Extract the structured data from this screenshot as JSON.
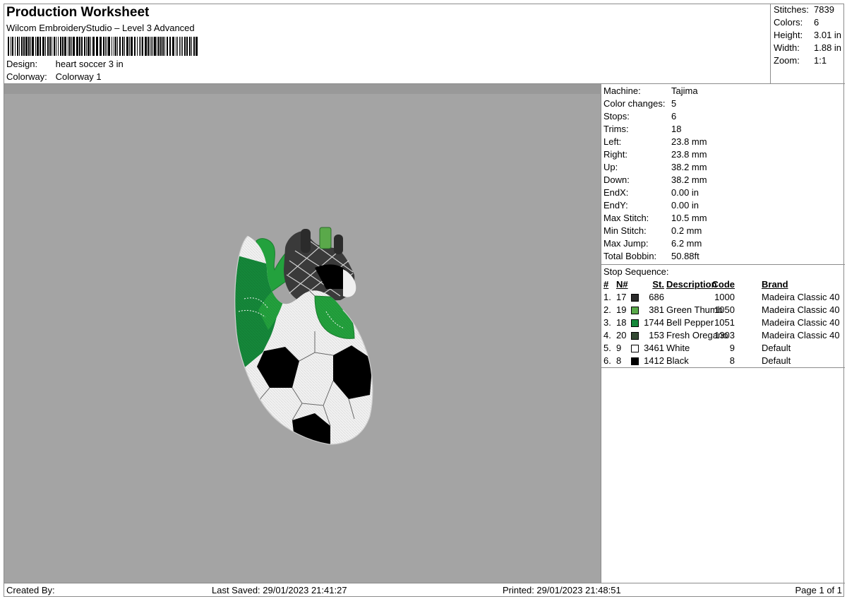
{
  "header": {
    "title": "Production Worksheet",
    "subtitle": "Wilcom EmbroideryStudio – Level 3 Advanced",
    "design_label": "Design:",
    "design_value": "heart soccer 3 in",
    "colorway_label": "Colorway:",
    "colorway_value": "Colorway 1"
  },
  "stats": [
    {
      "label": "Stitches:",
      "value": "7839"
    },
    {
      "label": "Colors:",
      "value": "6"
    },
    {
      "label": "Height:",
      "value": "3.01 in"
    },
    {
      "label": "Width:",
      "value": "1.88 in"
    },
    {
      "label": "Zoom:",
      "value": "1:1"
    }
  ],
  "machine_info": [
    {
      "label": "Machine:",
      "value": "Tajima"
    },
    {
      "label": "Color changes:",
      "value": "5"
    },
    {
      "label": "Stops:",
      "value": "6"
    },
    {
      "label": "Trims:",
      "value": "18"
    },
    {
      "label": "Left:",
      "value": "23.8 mm"
    },
    {
      "label": "Right:",
      "value": "23.8 mm"
    },
    {
      "label": "Up:",
      "value": "38.2 mm"
    },
    {
      "label": "Down:",
      "value": "38.2 mm"
    },
    {
      "label": "EndX:",
      "value": "0.00 in"
    },
    {
      "label": "EndY:",
      "value": "0.00 in"
    },
    {
      "label": "Max Stitch:",
      "value": "10.5 mm"
    },
    {
      "label": "Min Stitch:",
      "value": "0.2 mm"
    },
    {
      "label": "Max Jump:",
      "value": "6.2 mm"
    },
    {
      "label": "Total Bobbin:",
      "value": "50.88ft"
    }
  ],
  "stop_sequence": {
    "title": "Stop Sequence:",
    "headers": {
      "num": "#",
      "n": "N#",
      "st": "St.",
      "desc": "Description",
      "code": "Code",
      "brand": "Brand"
    },
    "rows": [
      {
        "num": "1.",
        "n": "17",
        "color": "#2b2b2b",
        "st": "686",
        "desc": "",
        "code": "1000",
        "brand": "Madeira Classic 40"
      },
      {
        "num": "2.",
        "n": "19",
        "color": "#5aa94a",
        "st": "381",
        "desc": "Green Thumb",
        "code": "1050",
        "brand": "Madeira Classic 40"
      },
      {
        "num": "3.",
        "n": "18",
        "color": "#15883a",
        "st": "1744",
        "desc": "Bell Pepper",
        "code": "1051",
        "brand": "Madeira Classic 40"
      },
      {
        "num": "4.",
        "n": "20",
        "color": "#344a34",
        "st": "153",
        "desc": "Fresh Oregano",
        "code": "1303",
        "brand": "Madeira Classic 40"
      },
      {
        "num": "5.",
        "n": "9",
        "color": "#ffffff",
        "st": "3461",
        "desc": "White",
        "code": "9",
        "brand": "Default"
      },
      {
        "num": "6.",
        "n": "8",
        "color": "#000000",
        "st": "1412",
        "desc": "Black",
        "code": "8",
        "brand": "Default"
      }
    ]
  },
  "footer": {
    "created_by": "Created By:",
    "last_saved": "Last Saved: 29/01/2023 21:41:27",
    "printed": "Printed: 29/01/2023 21:48:51",
    "page": "Page 1 of 1"
  }
}
